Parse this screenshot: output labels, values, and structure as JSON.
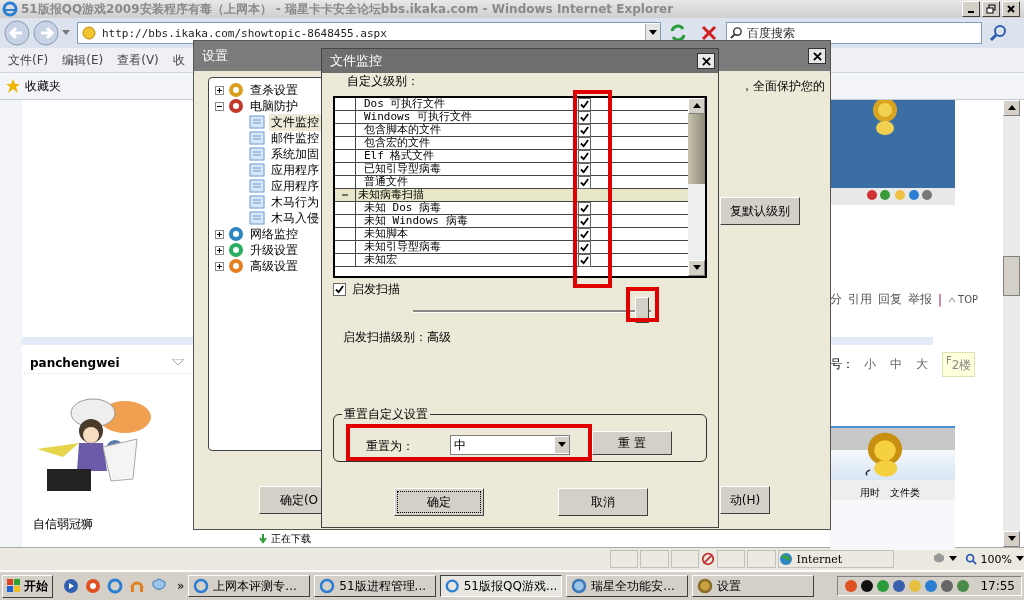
{
  "browser": {
    "title": "51版报QQ游戏2009安装程序有毒（上网本） - 瑞星卡卡安全论坛bbs.ikaka.com - Windows Internet Explorer",
    "url": "http://bbs.ikaka.com/showtopic-8648455.aspx",
    "search_placeholder": "百度搜索",
    "menu": [
      "文件(F)",
      "编辑(E)",
      "查看(V)",
      "收"
    ],
    "favorites": "收藏夹"
  },
  "page": {
    "user_name": "panchengwei",
    "user_title": "自信弱冠狮",
    "post_actions": [
      "分",
      "引用",
      "回复",
      "举报"
    ],
    "separator": "|",
    "top_link": "TOP",
    "font_size_label": "号：",
    "font_sizes": [
      "小",
      "中",
      "大"
    ],
    "floor": "$^{F}$2楼",
    "table_headers": [
      "用时",
      "文件类"
    ],
    "download_label": "正在下载"
  },
  "settings": {
    "title": "设置",
    "tree": [
      {
        "label": "查杀设置",
        "expanded": false
      },
      {
        "label": "电脑防护",
        "expanded": true,
        "children": [
          {
            "label": "文件监控",
            "selected": true
          },
          {
            "label": "邮件监控",
            "selected": false
          },
          {
            "label": "系统加固",
            "selected": false
          },
          {
            "label": "应用程序",
            "selected": false
          },
          {
            "label": "应用程序",
            "selected": false
          },
          {
            "label": "木马行为",
            "selected": false
          },
          {
            "label": "木马入侵",
            "selected": false
          }
        ]
      },
      {
        "label": "网络监控",
        "expanded": false
      },
      {
        "label": "升级设置",
        "expanded": false
      },
      {
        "label": "高级设置",
        "expanded": false
      }
    ],
    "description": "，全面保护您的",
    "restore_button": "复默认级别",
    "ok_button": "确定(O",
    "help_button": "动(H)"
  },
  "file_monitor": {
    "title": "文件监控",
    "custom_level_label": "自定义级别：",
    "sections": [
      {
        "items": [
          {
            "label": "Dos 可执行文件",
            "checked": true
          },
          {
            "label": "Windows 可执行文件",
            "checked": true
          },
          {
            "label": "包含脚本的文件",
            "checked": true
          },
          {
            "label": "包含宏的文件",
            "checked": true
          },
          {
            "label": "Elf 格式文件",
            "checked": true
          },
          {
            "label": "已知引导型病毒",
            "checked": true
          },
          {
            "label": "普通文件",
            "checked": true
          }
        ]
      },
      {
        "title": "未知病毒扫描",
        "expanded": true,
        "items": [
          {
            "label": "未知 Dos 病毒",
            "checked": true
          },
          {
            "label": "未知 Windows 病毒",
            "checked": true
          },
          {
            "label": "未知脚本",
            "checked": true
          },
          {
            "label": "未知引导型病毒",
            "checked": true
          },
          {
            "label": "未知宏",
            "checked": true
          }
        ]
      }
    ],
    "heuristic": {
      "label": "启发扫描",
      "checked": true,
      "level": 1,
      "level_text": "启发扫描级别：高级"
    },
    "reset": {
      "title": "重置自定义设置",
      "label": "重置为：",
      "value": "中",
      "button": "重 置"
    },
    "buttons": [
      "确定",
      "取消"
    ]
  },
  "status_bar": {
    "zone": "Internet",
    "zoom": "100%"
  },
  "taskbar": {
    "start": "开始",
    "more": "»",
    "tasks": [
      {
        "label": "上网本评测专...",
        "selected": false
      },
      {
        "label": "51版进程管理...",
        "selected": false
      },
      {
        "label": "51版报QQ游戏...",
        "selected": true
      },
      {
        "label": "瑞星全功能安...",
        "selected": false
      },
      {
        "label": "设置",
        "selected": false
      }
    ],
    "clock": "17:55"
  }
}
